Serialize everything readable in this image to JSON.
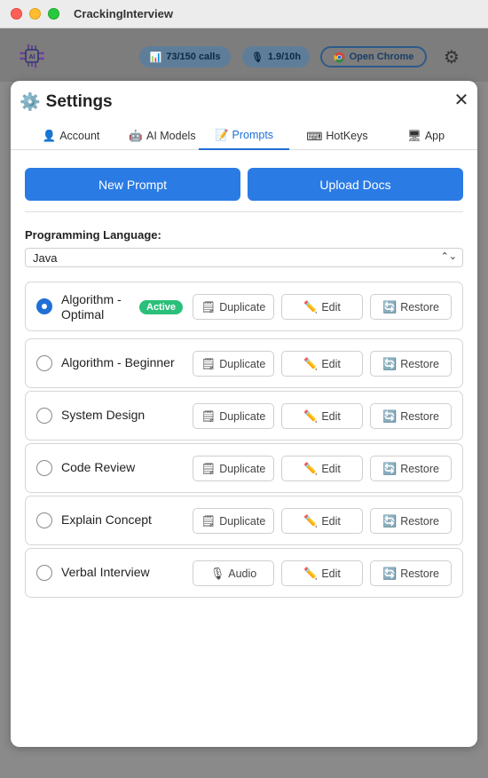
{
  "window": {
    "title": "CrackingInterview"
  },
  "header": {
    "calls_label": "73/150 calls",
    "rate_label": "1.9/10h",
    "chrome_label": "Open Chrome"
  },
  "settings": {
    "title": "Settings",
    "close": "✕",
    "tabs": [
      {
        "icon": "👤",
        "label": "Account"
      },
      {
        "icon": "🤖",
        "label": "AI Models"
      },
      {
        "icon": "📝",
        "label": "Prompts"
      },
      {
        "icon": "⌨",
        "label": "HotKeys"
      },
      {
        "icon": "🖥",
        "label": "App"
      }
    ],
    "buttons": {
      "new_prompt": "New Prompt",
      "upload_docs": "Upload Docs"
    },
    "language": {
      "label": "Programming Language:",
      "selected": "Java"
    },
    "prompts": [
      {
        "name": "Algorithm - Optimal",
        "active": true,
        "badge": "Active",
        "action1": "Duplicate",
        "action1_icon": "🗒",
        "edit": "Edit",
        "restore": "Restore"
      },
      {
        "name": "Algorithm - Beginner",
        "active": false,
        "action1": "Duplicate",
        "action1_icon": "🗒",
        "edit": "Edit",
        "restore": "Restore"
      },
      {
        "name": "System Design",
        "active": false,
        "action1": "Duplicate",
        "action1_icon": "🗒",
        "edit": "Edit",
        "restore": "Restore"
      },
      {
        "name": "Code Review",
        "active": false,
        "action1": "Duplicate",
        "action1_icon": "🗒",
        "edit": "Edit",
        "restore": "Restore"
      },
      {
        "name": "Explain Concept",
        "active": false,
        "action1": "Duplicate",
        "action1_icon": "🗒",
        "edit": "Edit",
        "restore": "Restore"
      },
      {
        "name": "Verbal Interview",
        "active": false,
        "action1": "Audio",
        "action1_icon": "🎙",
        "edit": "Edit",
        "restore": "Restore"
      }
    ],
    "icons": {
      "edit": "✏️",
      "restore": "🔄"
    },
    "colors": {
      "accent": "#2a7be4",
      "active_badge": "#2bc07a"
    }
  }
}
